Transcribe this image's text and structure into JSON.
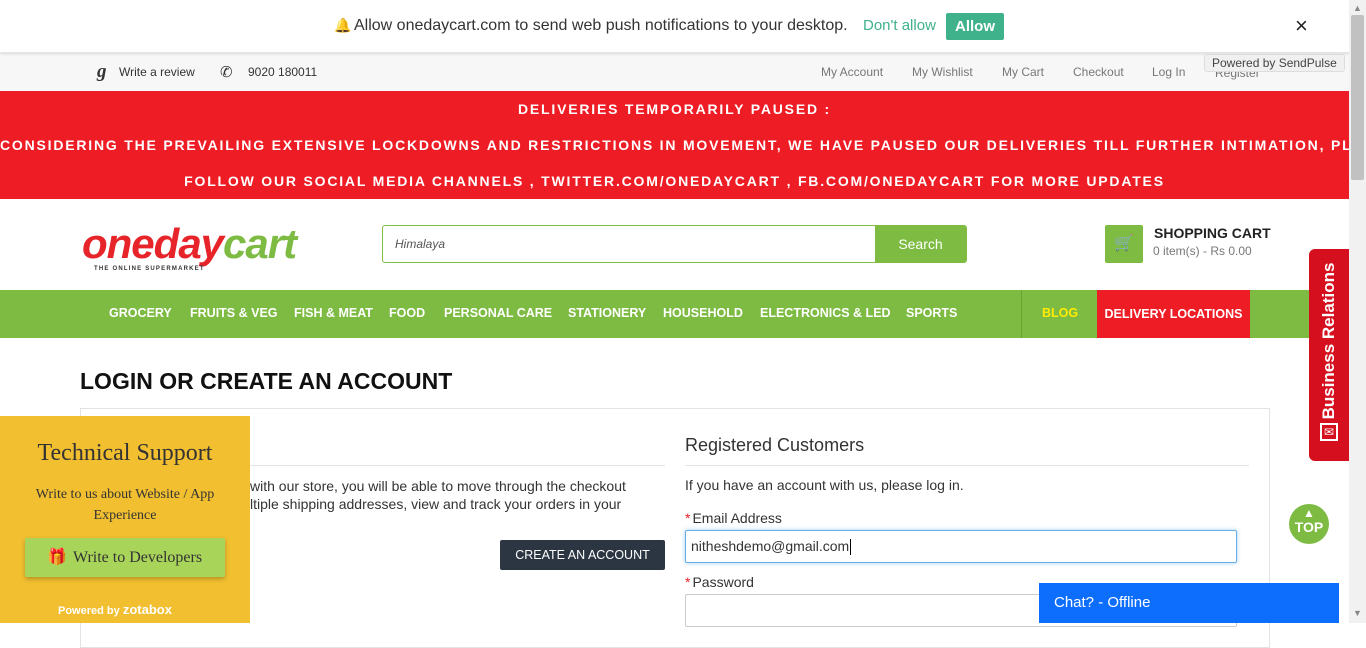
{
  "push": {
    "message": "Allow onedaycart.com to send web push notifications to your desktop.",
    "dont_allow": "Don't allow",
    "allow": "Allow",
    "close": "×",
    "powered": "Powered by SendPulse"
  },
  "toplinks": {
    "review": "Write a review",
    "phone": "9020 180011",
    "my_account": "My Account",
    "my_wishlist": "My Wishlist",
    "my_cart": "My Cart",
    "checkout": "Checkout",
    "login": "Log In",
    "register": "Register"
  },
  "banner": {
    "line1": "DELIVERIES TEMPORARILY PAUSED :",
    "line2": "CONSIDERING THE PREVAILING EXTENSIVE LOCKDOWNS AND RESTRICTIONS IN MOVEMENT, WE HAVE PAUSED OUR DELIVERIES TILL FURTHER INTIMATION, PLEASE",
    "line3": "FOLLOW OUR SOCIAL MEDIA CHANNELS , TWITTER.COM/ONEDAYCART , FB.COM/ONEDAYCART FOR MORE UPDATES"
  },
  "logo": {
    "part1": "oneday",
    "part2": "cart",
    "tagline": "THE ONLINE SUPERMARKET"
  },
  "search": {
    "value": "Himalaya",
    "button": "Search"
  },
  "cart": {
    "title": "SHOPPING CART",
    "summary": "0 item(s) - Rs 0.00"
  },
  "nav": {
    "items": [
      "GROCERY",
      "FRUITS & VEG",
      "FISH & MEAT",
      "FOOD",
      "PERSONAL CARE",
      "STATIONERY",
      "HOUSEHOLD",
      "ELECTRONICS & LED",
      "SPORTS"
    ],
    "blog": "BLOG",
    "delivery": "DELIVERY LOCATIONS"
  },
  "page": {
    "title": "LOGIN OR CREATE AN ACCOUNT",
    "new_line1": "with our store, you will be able to move through the checkout",
    "new_line2": "ltiple shipping addresses, view and track your orders in your",
    "create_button": "CREATE AN ACCOUNT",
    "registered_title": "Registered Customers",
    "registered_text": "If you have an account with us, please log in.",
    "email_label": "Email Address",
    "email_value": "nitheshdemo@gmail.com",
    "password_label": "Password",
    "required_mark": "*"
  },
  "support": {
    "title": "Technical Support",
    "desc": "Write to us about Website / App Experience",
    "button": "Write to Developers",
    "powered": "Powered by",
    "brand": "zotabox"
  },
  "side_tab": {
    "label": "Business Relations"
  },
  "top_button": {
    "label": "TOP"
  },
  "chat": {
    "label": "Chat? - Offline"
  },
  "colors": {
    "green": "#7dbb42",
    "red": "#ee1c25",
    "chat_blue": "#0d6efd",
    "support_yellow": "#f1bf30"
  }
}
